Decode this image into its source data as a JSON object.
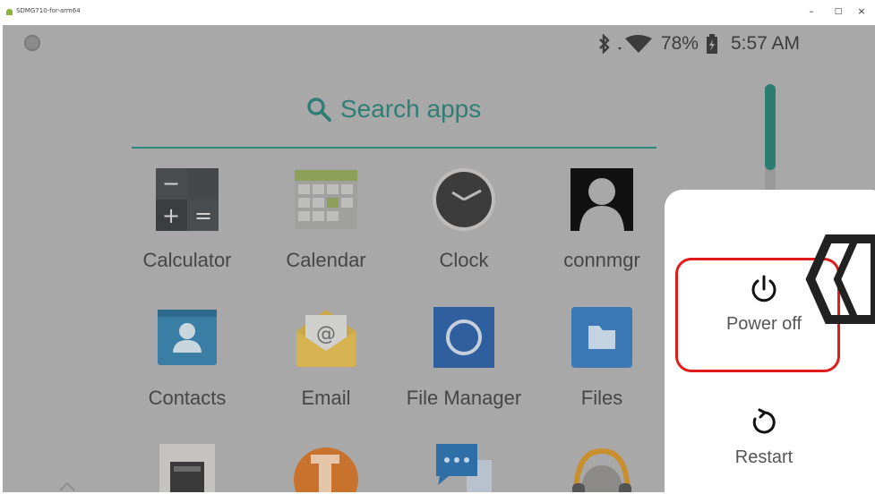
{
  "window": {
    "title": "SDMG710-for-arm64",
    "minimize": "–",
    "maximize": "□",
    "close": "×"
  },
  "status_bar": {
    "battery": "78%",
    "time": "5:57 AM"
  },
  "search": {
    "label": "Search apps"
  },
  "apps": [
    {
      "label": "Calculator",
      "icon": "calculator-icon"
    },
    {
      "label": "Calendar",
      "icon": "calendar-icon"
    },
    {
      "label": "Clock",
      "icon": "clock-icon"
    },
    {
      "label": "connmgr",
      "icon": "connmgr-icon"
    },
    {
      "label": "Contacts",
      "icon": "contacts-icon"
    },
    {
      "label": "Email",
      "icon": "email-icon"
    },
    {
      "label": "File Manager",
      "icon": "file-manager-icon"
    },
    {
      "label": "Files",
      "icon": "files-icon"
    }
  ],
  "power_menu": {
    "power_off": "Power off",
    "restart": "Restart"
  },
  "colors": {
    "scrim": "#a9a8a8",
    "accent": "#2a8a7d",
    "highlight": "#e01b1b"
  }
}
